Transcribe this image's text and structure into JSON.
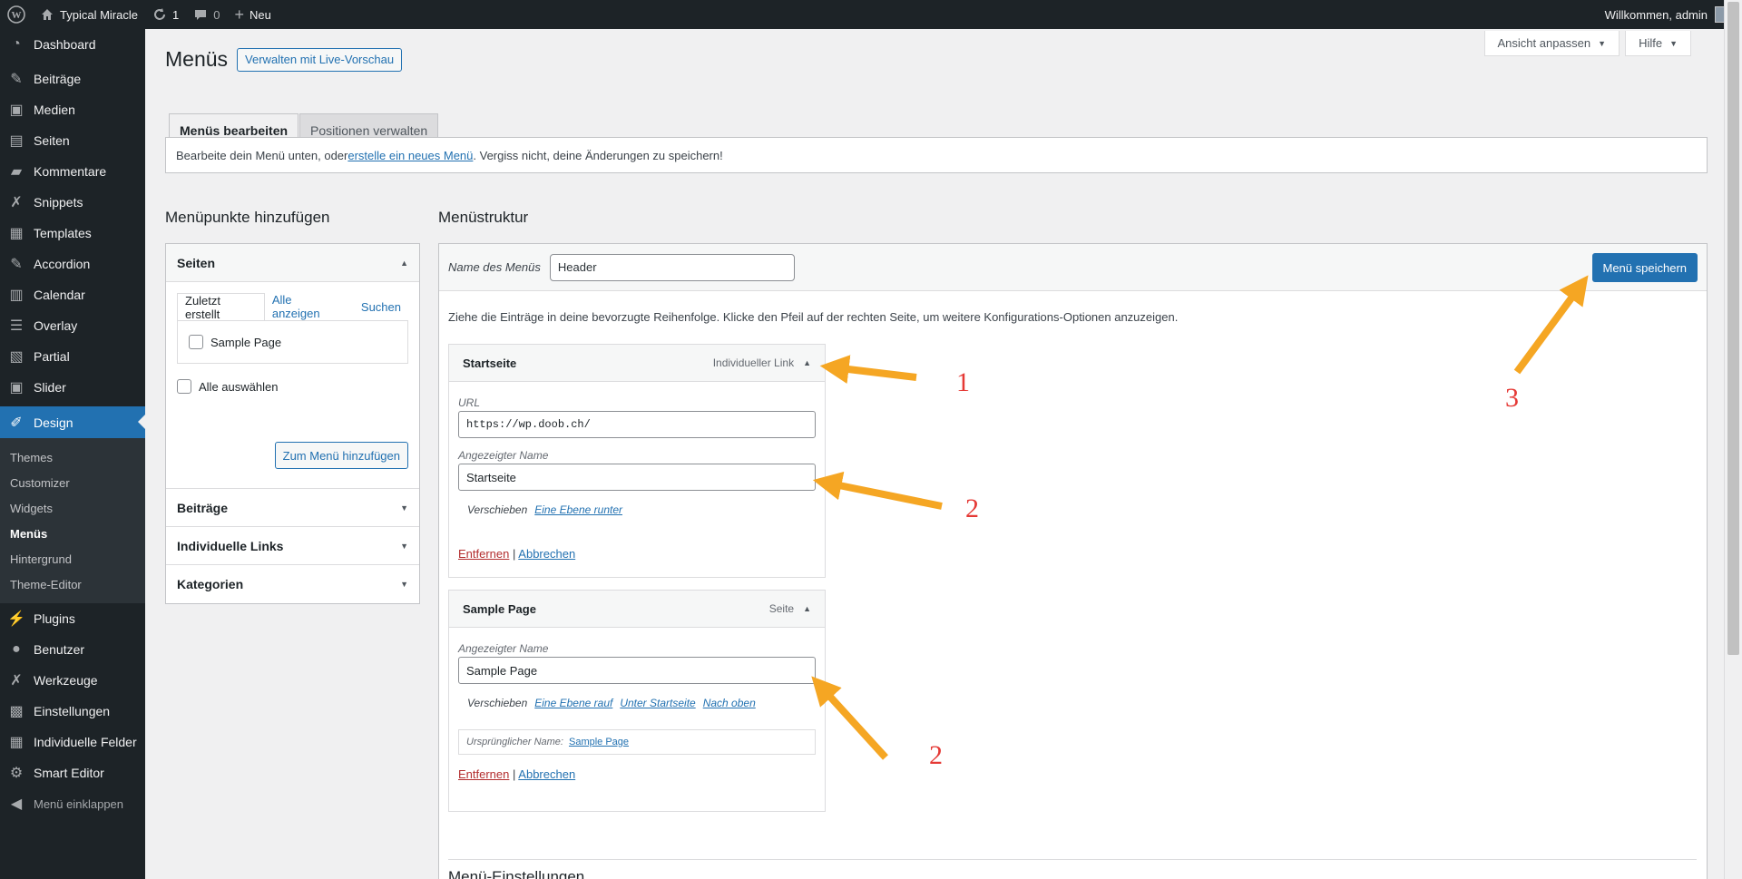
{
  "adminbar": {
    "site_name": "Typical Miracle",
    "updates_count": "1",
    "comments_count": "0",
    "new_label": "Neu",
    "welcome": "Willkommen, admin"
  },
  "sidebar": {
    "items": [
      {
        "label": "Dashboard",
        "icon": "dashboard-icon"
      },
      {
        "label": "Beiträge",
        "icon": "pin-icon"
      },
      {
        "label": "Medien",
        "icon": "media-icon"
      },
      {
        "label": "Seiten",
        "icon": "pages-icon"
      },
      {
        "label": "Kommentare",
        "icon": "comment-icon"
      },
      {
        "label": "Snippets",
        "icon": "wrench-icon"
      },
      {
        "label": "Templates",
        "icon": "table-icon"
      },
      {
        "label": "Accordion",
        "icon": "pin-icon"
      },
      {
        "label": "Calendar",
        "icon": "calendar-icon"
      },
      {
        "label": "Overlay",
        "icon": "list-icon"
      },
      {
        "label": "Partial",
        "icon": "layout-icon"
      },
      {
        "label": "Slider",
        "icon": "media-icon"
      },
      {
        "label": "Design",
        "icon": "brush-icon"
      }
    ],
    "submenu": [
      "Themes",
      "Customizer",
      "Widgets",
      "Menüs",
      "Hintergrund",
      "Theme-Editor"
    ],
    "items2": [
      {
        "label": "Plugins",
        "icon": "plugin-icon"
      },
      {
        "label": "Benutzer",
        "icon": "user-icon"
      },
      {
        "label": "Werkzeuge",
        "icon": "wrench-icon"
      },
      {
        "label": "Einstellungen",
        "icon": "settings-icon"
      },
      {
        "label": "Individuelle Felder",
        "icon": "table-icon"
      },
      {
        "label": "Smart Editor",
        "icon": "gear-icon"
      }
    ],
    "collapse_label": "Menü einklappen"
  },
  "header": {
    "screen_options": "Ansicht anpassen",
    "help": "Hilfe",
    "title": "Menüs",
    "live_preview": "Verwalten mit Live-Vorschau",
    "tab_edit": "Menüs bearbeiten",
    "tab_locations": "Positionen verwalten"
  },
  "notice": {
    "prefix": "Bearbeite dein Menü unten, oder ",
    "link": "erstelle ein neues Menü",
    "suffix": ". Vergiss nicht, deine Änderungen zu speichern!"
  },
  "left": {
    "title": "Menüpunkte hinzufügen",
    "pages_heading": "Seiten",
    "tab_recent": "Zuletzt erstellt",
    "tab_all": "Alle anzeigen",
    "tab_search": "Suchen",
    "page_item": "Sample Page",
    "select_all": "Alle auswählen",
    "add_button": "Zum Menü hinzufügen",
    "posts_heading": "Beiträge",
    "links_heading": "Individuelle Links",
    "categories_heading": "Kategorien"
  },
  "right": {
    "title": "Menüstruktur",
    "menu_name_label": "Name des Menüs",
    "menu_name_value": "Header",
    "save_button": "Menü speichern",
    "instructions": "Ziehe die Einträge in deine bevorzugte Reihenfolge. Klicke den Pfeil auf der rechten Seite, um weitere Konfigurations-Optionen anzuzeigen.",
    "item1": {
      "title": "Startseite",
      "type": "Individueller Link",
      "url_label": "URL",
      "url_value": "https://wp.doob.ch/",
      "name_label": "Angezeigter Name",
      "name_value": "Startseite",
      "move_label": "Verschieben",
      "move_down": "Eine Ebene runter",
      "remove": "Entfernen",
      "sep": "|",
      "cancel": "Abbrechen"
    },
    "item2": {
      "title": "Sample Page",
      "type": "Seite",
      "name_label": "Angezeigter Name",
      "name_value": "Sample Page",
      "move_label": "Verschieben",
      "move_up": "Eine Ebene rauf",
      "move_under": "Unter Startseite",
      "move_top": "Nach oben",
      "original_label": "Ursprünglicher Name:",
      "original_link": "Sample Page",
      "remove": "Entfernen",
      "sep": "|",
      "cancel": "Abbrechen"
    },
    "settings_title": "Menü-Einstellungen"
  },
  "annotations": {
    "n1": "1",
    "n2a": "2",
    "n2b": "2",
    "n3": "3"
  },
  "colors": {
    "accent": "#2271b1",
    "sidebar": "#1d2327",
    "arrow": "#f5a623",
    "annotation": "#e53935"
  }
}
